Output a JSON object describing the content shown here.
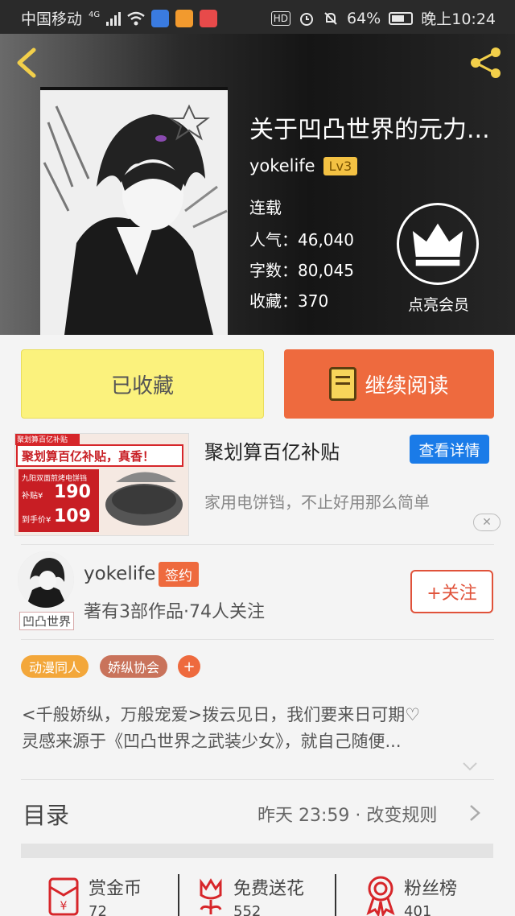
{
  "status_bar": {
    "carrier": "中国移动",
    "network": "4G",
    "hd_label": "HD",
    "battery": "64%",
    "time": "晚上10:24"
  },
  "book": {
    "title": "关于凹凸世界的元力...",
    "author": "yokelife",
    "level": "Lv3",
    "status": "连载",
    "popularity": "人气：46,040",
    "word_count": "字数：80,045",
    "favorites": "收藏：370",
    "member_label": "点亮会员"
  },
  "actions": {
    "favorited_label": "已收藏",
    "continue_label": "继续阅读"
  },
  "ad": {
    "banner_header": "聚划算百亿补贴",
    "banner_slogan": "聚划算百亿补贴，真香！",
    "banner_product": "九阳双面煎烤电饼铛",
    "banner_subsidy_label": "补贴¥",
    "banner_subsidy_value": "190",
    "banner_price_label": "到手价¥",
    "banner_price_value": "109",
    "title": "聚划算百亿补贴",
    "details_label": "查看详情",
    "description": "家用电饼铛，不止好用那么简单",
    "close": "✕"
  },
  "author_card": {
    "name": "yokelife",
    "signed_badge": "签约",
    "info": "著有3部作品·74人关注",
    "avatar_tag": "凹凸世界",
    "follow_label": "+关注"
  },
  "tags": [
    {
      "label": "动漫同人",
      "color": "#f3a73a"
    },
    {
      "label": "娇纵协会",
      "color": "#c9735b"
    }
  ],
  "add_tag_label": "+",
  "synopsis": {
    "line1": "<千般娇纵，万般宠爱>拨云见日，我们要来日可期♡",
    "line2": "灵感来源于《凹凸世界之武装少女》，就自己随便..."
  },
  "toc": {
    "title": "目录",
    "update_text": "昨天 23:59 · 改变规则"
  },
  "bottom_stats": [
    {
      "label": "赏金币",
      "value": "72"
    },
    {
      "label": "免费送花",
      "value": "552"
    },
    {
      "label": "粉丝榜",
      "value": "401"
    }
  ],
  "colors": {
    "accent_orange": "#ee6a3e",
    "favorite_yellow": "#fbf27d",
    "level_gold": "#f3c143",
    "ad_blue": "#1a7be8"
  }
}
